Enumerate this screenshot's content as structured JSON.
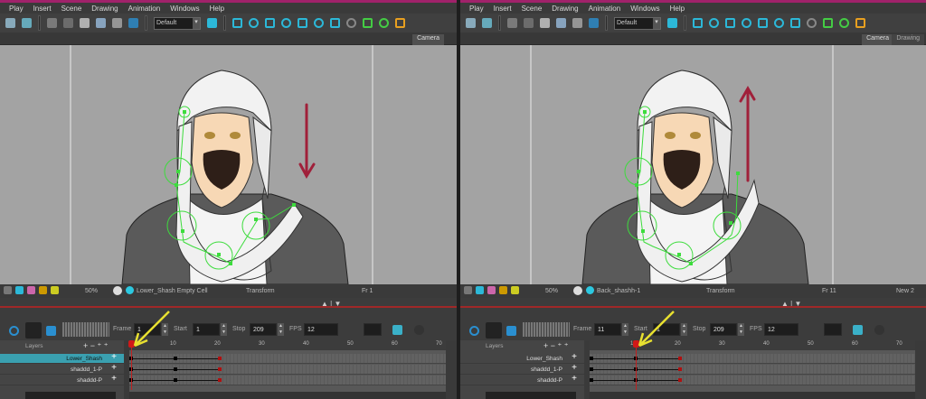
{
  "menu": [
    "Play",
    "Insert",
    "Scene",
    "Drawing",
    "Animation",
    "Windows",
    "Help"
  ],
  "toolbar": {
    "preset": "Default"
  },
  "colors": {
    "accent": "#a0226a",
    "teal": "#3aa0b0",
    "key": "#b01010",
    "arrow": "#a0203a",
    "deformer": "#3ddc3d"
  },
  "panes": [
    {
      "tabs": [
        "Camera"
      ],
      "zoom": "50%",
      "drawing": "Lower_Shash Empty Cell",
      "tool": "Transform",
      "frame_status": "Fr 1",
      "extra": "",
      "frame": "1",
      "start": "1",
      "stop": "209",
      "fps": "12",
      "arrow": "down",
      "current_frame": 1,
      "layers_label": "Layers",
      "layers": [
        "Lower_Shash",
        "shaddd_1-P",
        "shaddd-P"
      ],
      "ruler": [
        "10",
        "20",
        "30",
        "40",
        "50",
        "60",
        "70"
      ],
      "frame_label": "Frame",
      "start_label": "Start",
      "stop_label": "Stop",
      "fps_label": "FPS"
    },
    {
      "tabs": [
        "Camera",
        "Drawing"
      ],
      "zoom": "50%",
      "drawing": "Back_shashh-1",
      "tool": "Transform",
      "frame_status": "Fr 11",
      "extra": "New 2",
      "frame": "11",
      "start": "1",
      "stop": "209",
      "fps": "12",
      "arrow": "up",
      "current_frame": 11,
      "layers_label": "Layers",
      "layers": [
        "Lower_Shash",
        "shaddd_1-P",
        "shaddd-P"
      ],
      "ruler": [
        "10",
        "20",
        "30",
        "40",
        "50",
        "60",
        "70"
      ],
      "frame_label": "Frame",
      "start_label": "Start",
      "stop_label": "Stop",
      "fps_label": "FPS"
    }
  ],
  "keyframes": [
    1,
    11,
    21
  ]
}
